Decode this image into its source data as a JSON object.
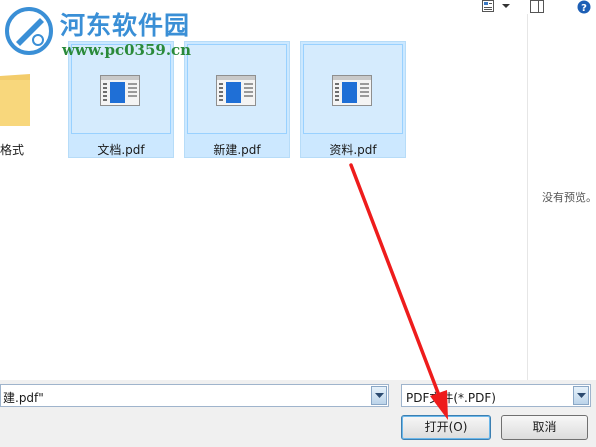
{
  "watermark": {
    "title": "河东软件园",
    "url": "www.pc0359.cn"
  },
  "toolbar": {
    "icons": [
      "view-options-icon",
      "chevron-down-icon",
      "preview-pane-icon",
      "help-icon"
    ]
  },
  "folder": {
    "label": "格式"
  },
  "files": [
    {
      "name": "文档.pdf"
    },
    {
      "name": "新建.pdf"
    },
    {
      "name": "资料.pdf"
    }
  ],
  "preview": {
    "empty_text": "没有预览。"
  },
  "filename_field": {
    "value": "建.pdf\""
  },
  "file_type_filter": {
    "selected": "PDF文件(*.PDF)"
  },
  "buttons": {
    "open_label": "打开(O)",
    "cancel_label": "取消"
  },
  "colors": {
    "selection_bg": "#cce8ff",
    "selection_border": "#99d1ff",
    "annotation_arrow": "#ee1c1c",
    "watermark_title": "#3a8fd6",
    "watermark_url": "#2a8a3a"
  }
}
